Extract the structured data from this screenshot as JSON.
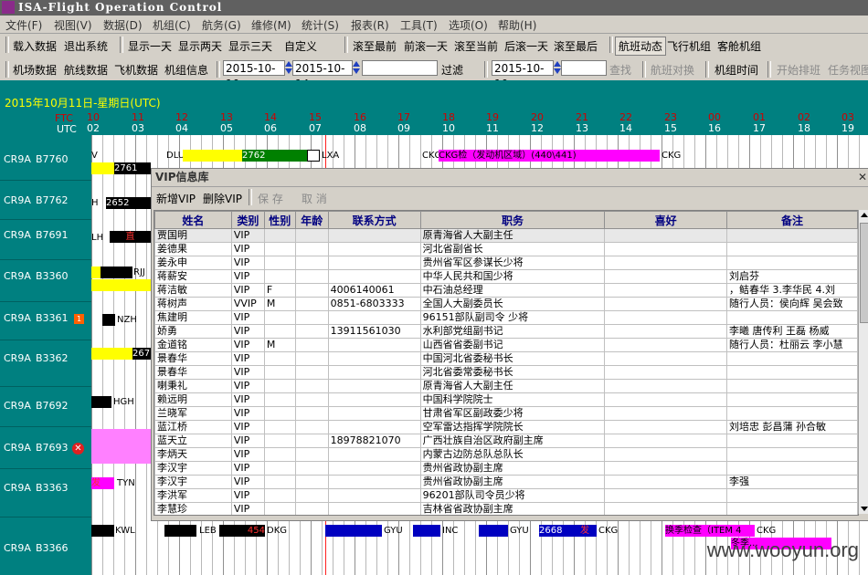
{
  "app": {
    "title": "ISA-Flight Operation Control"
  },
  "menu": [
    "文件(F)",
    "视图(V)",
    "数据(D)",
    "机组(C)",
    "航务(G)",
    "维修(M)",
    "统计(S)",
    "报表(R)",
    "工具(T)",
    "选项(O)",
    "帮助(H)"
  ],
  "toolbar1": {
    "load_data": "载入数据",
    "exit": "退出系统",
    "show_1": "显示一天",
    "show_2": "显示两天",
    "show_3": "显示三天",
    "custom": "自定义",
    "scroll_first": "滚至最前",
    "back_day": "前滚一天",
    "scroll_now": "滚至当前",
    "fwd_day": "后滚一天",
    "scroll_last": "滚至最后",
    "flight_dyn": "航班动态",
    "aircrew": "飞行机组",
    "cabin_crew": "客舱机组"
  },
  "toolbar2": {
    "airport_data": "机场数据",
    "route_data": "航线数据",
    "aircraft_data": "飞机数据",
    "crew_info": "机组信息",
    "date_from": "2015-10-10",
    "date_to": "2015-10-14",
    "filter": "过滤",
    "search_date": "2015-10-10",
    "search": "查找",
    "swap": "航班对换",
    "crew_time": "机组时间",
    "start_schedule": "开始排班",
    "task_view": "任务视图"
  },
  "gantt": {
    "date_title": "2015年10月11日-星期日(UTC)",
    "ftc_label": "FTC",
    "utc_label": "UTC",
    "hours_ftc": [
      "10",
      "11",
      "12",
      "13",
      "14",
      "15",
      "16",
      "17",
      "18",
      "19",
      "20",
      "21",
      "22",
      "23",
      "00",
      "01",
      "02",
      "03"
    ],
    "hours_utc": [
      "02",
      "03",
      "04",
      "05",
      "06",
      "07",
      "08",
      "09",
      "10",
      "11",
      "12",
      "13",
      "14",
      "15",
      "16",
      "17",
      "18",
      "19"
    ],
    "aircraft": [
      {
        "type": "CR9A",
        "reg": "B7760"
      },
      {
        "type": "CR9A",
        "reg": "B7762"
      },
      {
        "type": "CR9A",
        "reg": "B7691"
      },
      {
        "type": "CR9A",
        "reg": "B3360"
      },
      {
        "type": "CR9A",
        "reg": "B3361",
        "badge": "1"
      },
      {
        "type": "CR9A",
        "reg": "B3362"
      },
      {
        "type": "CR9A",
        "reg": "B7692"
      },
      {
        "type": "CR9A",
        "reg": "B7693"
      },
      {
        "type": "CR9A",
        "reg": "B3363"
      },
      {
        "type": "CR9A",
        "reg": "B3366"
      }
    ],
    "bar_labels": {
      "r1_a": "2762",
      "r1_b": "2761",
      "r1_c": "DLU",
      "r1_d": "LXA",
      "r1_maint": "CKG检（发动机区域）(440\\441)",
      "r1_maint_end": "CKG",
      "r2_a": "2652",
      "r2_h": "H",
      "r3_a": "直",
      "r3_lh": "LH",
      "r4_a": "RJJ",
      "r5_a": "NZH",
      "r6_a": "267",
      "r7_a": "HGH",
      "r9_a": "发",
      "r9_b": "TYN",
      "r10": [
        "KWL",
        "LEB",
        "454",
        "DKG",
        "GYU",
        "INC",
        "GYU",
        "2668",
        "发",
        "CKG",
        "换季检查（ITEM 4",
        "CKG",
        "冬季..."
      ]
    }
  },
  "vip": {
    "title": "VIP信息库",
    "tools": [
      "新增VIP",
      "删除VIP",
      "保  存",
      "取  消"
    ],
    "columns": [
      "姓名",
      "类别",
      "性别",
      "年龄",
      "联系方式",
      "职务",
      "喜好",
      "备注"
    ],
    "rows": [
      [
        "贾国明",
        "VIP",
        "",
        "",
        "",
        "原青海省人大副主任",
        "",
        ""
      ],
      [
        "姜德果",
        "VIP",
        "",
        "",
        "",
        "河北省副省长",
        "",
        ""
      ],
      [
        "姜永申",
        "VIP",
        "",
        "",
        "",
        "贵州省军区参谋长少将",
        "",
        ""
      ],
      [
        "蒋薪安",
        "VIP",
        "",
        "",
        "",
        "中华人民共和国少将",
        "",
        "刘启芬"
      ],
      [
        "蒋洁敏",
        "VIP",
        "F",
        "",
        "4006140061",
        "中石油总经理",
        "",
        "，鲒春华  3.李华民 4.刘"
      ],
      [
        "蒋树声",
        "VVIP",
        "M",
        "",
        "0851-6803333",
        "全国人大副委员长",
        "",
        "随行人员：侯向辉 吴会致"
      ],
      [
        "焦建明",
        "VIP",
        "",
        "",
        "",
        "96151部队副司令  少将",
        "",
        ""
      ],
      [
        "娇勇",
        "VIP",
        "",
        "",
        "13911561030",
        "水利部党组副书记",
        "",
        "李曦 唐传利 王磊 杨威"
      ],
      [
        "金道铭",
        "VIP",
        "M",
        "",
        "",
        "山西省省委副书记",
        "",
        "随行人员：杜丽云 李小慧"
      ],
      [
        "景春华",
        "VIP",
        "",
        "",
        "",
        "中国河北省委秘书长",
        "",
        ""
      ],
      [
        "景春华",
        "VIP",
        "",
        "",
        "",
        "河北省委常委秘书长",
        "",
        ""
      ],
      [
        "喇秉礼",
        "VIP",
        "",
        "",
        "",
        "原青海省人大副主任",
        "",
        ""
      ],
      [
        "赖远明",
        "VIP",
        "",
        "",
        "",
        "中国科学院院士",
        "",
        ""
      ],
      [
        "兰晓军",
        "VIP",
        "",
        "",
        "",
        "甘肃省军区副政委少将",
        "",
        ""
      ],
      [
        "蓝江桥",
        "VIP",
        "",
        "",
        "",
        "空军雷达指挥学院院长",
        "",
        "刘培忠  彭昌蒲 孙合敏"
      ],
      [
        "蓝天立",
        "VIP",
        "",
        "",
        "18978821070",
        "广西壮族自治区政府副主席",
        "",
        ""
      ],
      [
        "李炳天",
        "VIP",
        "",
        "",
        "",
        "内蒙古边防总队总队长",
        "",
        ""
      ],
      [
        "李汉宇",
        "VIP",
        "",
        "",
        "",
        "贵州省政协副主席",
        "",
        ""
      ],
      [
        "李汉宇",
        "VIP",
        "",
        "",
        "",
        "贵州省政协副主席",
        "",
        "李强"
      ],
      [
        "李洪军",
        "VIP",
        "",
        "",
        "",
        "96201部队司令员少将",
        "",
        ""
      ],
      [
        "李慧珍",
        "VIP",
        "",
        "",
        "",
        "吉林省省政协副主席",
        "",
        ""
      ]
    ]
  },
  "watermark": "www.wooyun.org",
  "colors": {
    "teal": "#008080",
    "yellow": "#ffff00",
    "magenta": "#ff00ff",
    "green": "#008000",
    "blue": "#0000c0"
  }
}
